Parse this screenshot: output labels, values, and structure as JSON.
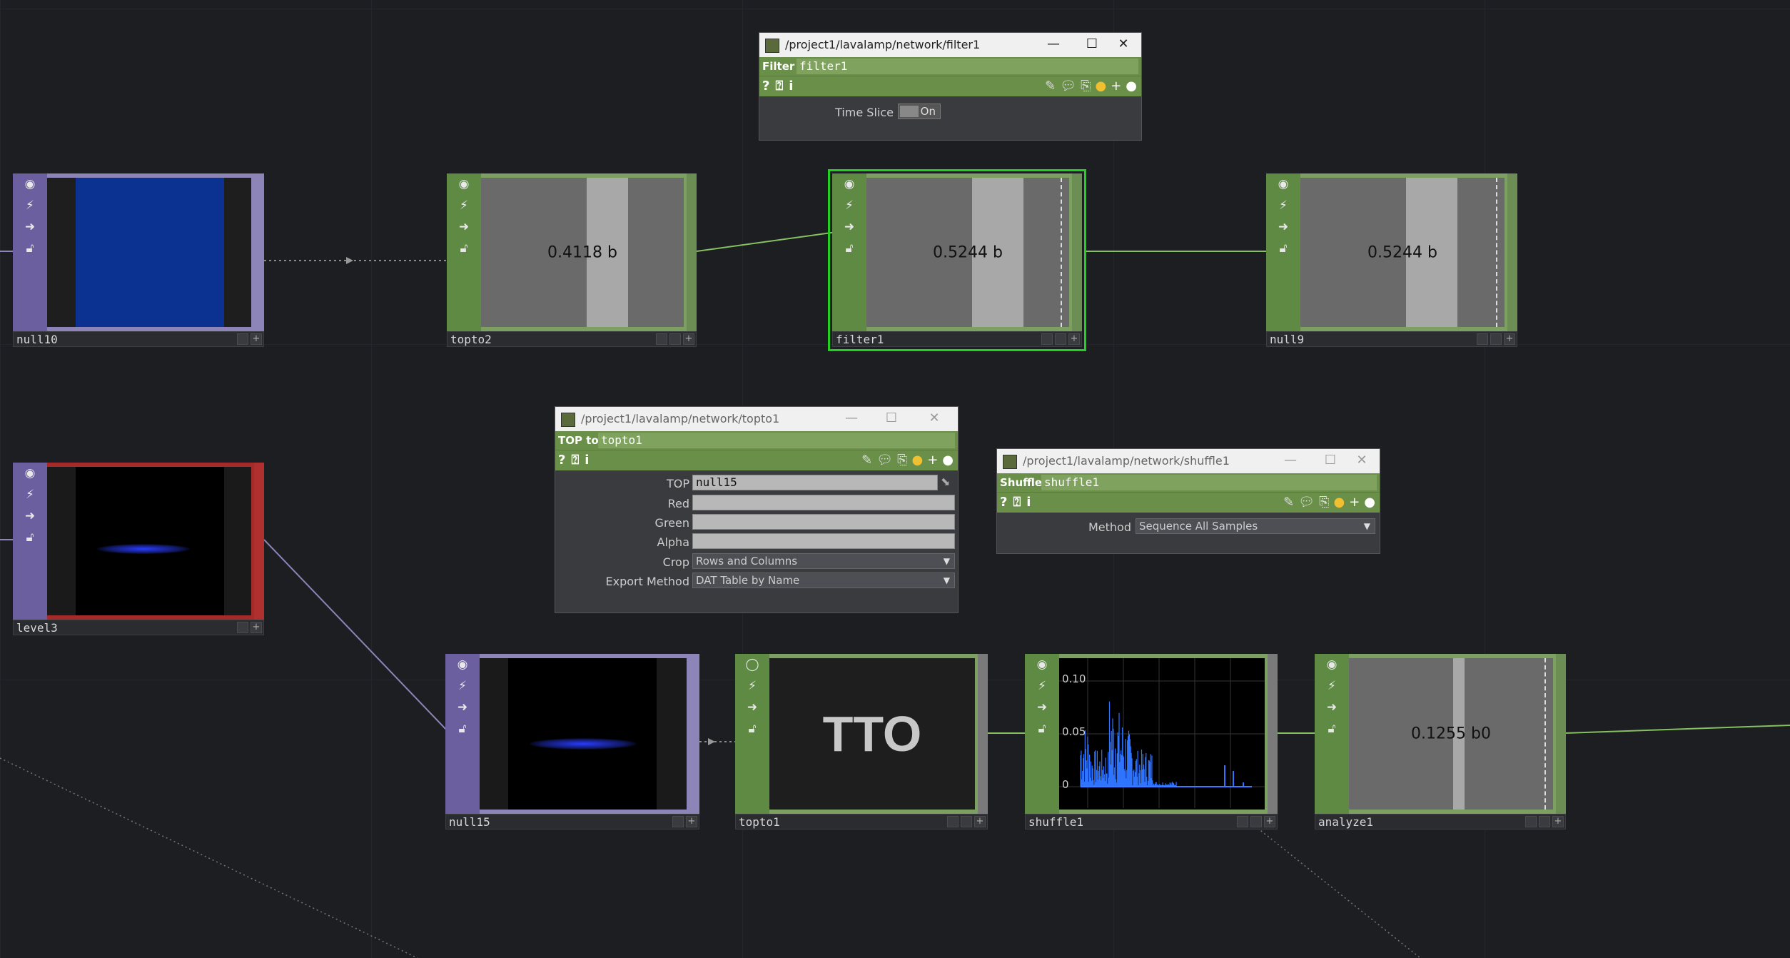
{
  "nodes": {
    "null10": {
      "name": "null10"
    },
    "topto2": {
      "name": "topto2",
      "value": "0.4118 b"
    },
    "filter1": {
      "name": "filter1",
      "value": "0.5244 b"
    },
    "null9": {
      "name": "null9",
      "value": "0.5244 b"
    },
    "level3": {
      "name": "level3"
    },
    "null15": {
      "name": "null15"
    },
    "topto1": {
      "name": "topto1",
      "logo": "TTO"
    },
    "shuffle1": {
      "name": "shuffle1",
      "tick_top": "0.10",
      "tick_mid": "0.05",
      "tick_zero": "0"
    },
    "analyze1": {
      "name": "analyze1",
      "value": "0.1255 b0"
    }
  },
  "dialogs": {
    "filter": {
      "title": "/project1/lavalamp/network/filter1",
      "type_label": "Filter",
      "node_name": "filter1",
      "params": {
        "time_slice_label": "Time Slice",
        "time_slice_value": "On"
      }
    },
    "topto": {
      "title": "/project1/lavalamp/network/topto1",
      "type_label": "TOP to",
      "node_name": "topto1",
      "params": {
        "top_label": "TOP",
        "top_value": "null15",
        "red_label": "Red",
        "green_label": "Green",
        "alpha_label": "Alpha",
        "crop_label": "Crop",
        "crop_value": "Rows and Columns",
        "export_label": "Export Method",
        "export_value": "DAT Table by Name"
      }
    },
    "shuffle": {
      "title": "/project1/lavalamp/network/shuffle1",
      "type_label": "Shuffle",
      "node_name": "shuffle1",
      "params": {
        "method_label": "Method",
        "method_value": "Sequence All Samples"
      }
    }
  },
  "window_buttons": {
    "minimize": "—",
    "maximize": "☐",
    "close": "✕"
  },
  "toolbar_icons": [
    "help-icon",
    "python-help-icon",
    "info-icon",
    "edit-icon",
    "comment-icon",
    "copy-icon",
    "python-icon",
    "plus-icon",
    "dot-icon"
  ],
  "strip_flags": [
    "viewer-flag-icon",
    "cook-flag-icon",
    "display-flag-icon",
    "lock-flag-icon"
  ],
  "colors": {
    "background": "#1d1e22",
    "top_operator": "#8d85b8",
    "chop_operator": "#7c9f62",
    "selected": "#22d022",
    "error": "#a52a2a"
  }
}
